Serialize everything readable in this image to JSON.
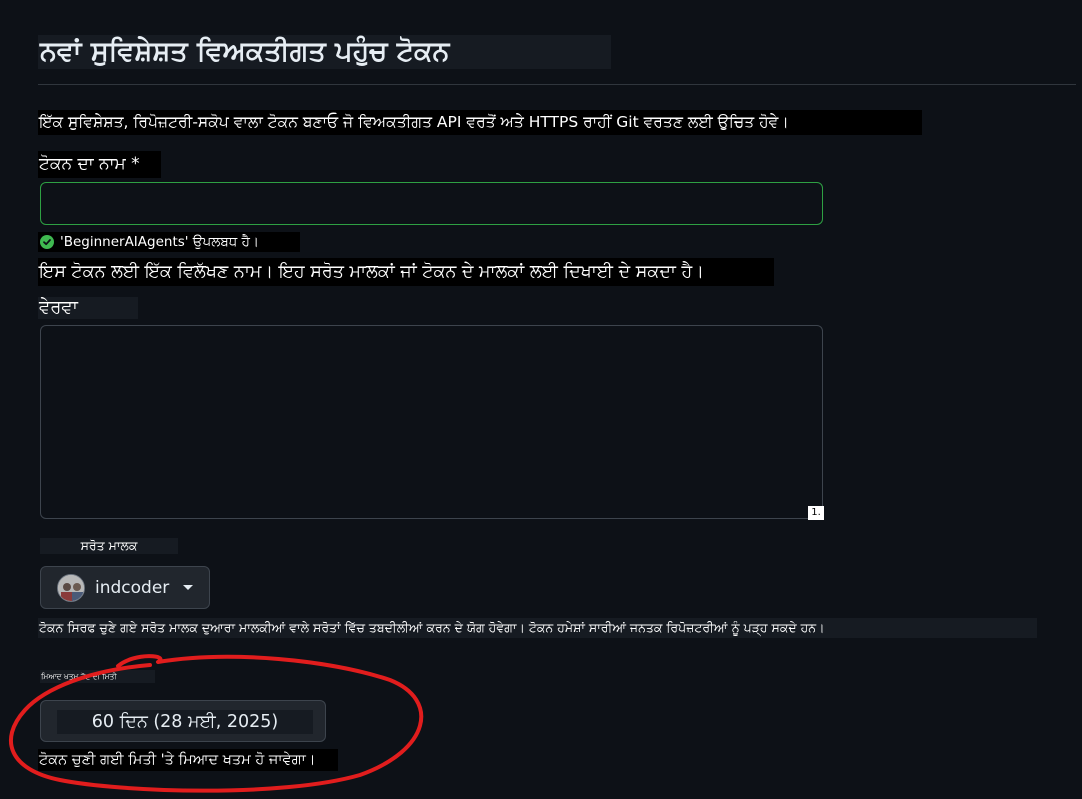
{
  "page": {
    "title": "ਨਵਾਂ ਸੁਵਿਸ਼ੇਸ਼ਤ ਵਿਅਕਤੀਗਤ ਪਹੁੰਚ ਟੋਕਨ",
    "intro": "ਇੱਕ ਸੁਵਿਸ਼ੇਸ਼ਤ, ਰਿਪੋਜ਼ਟਰੀ-ਸਕੋਪ ਵਾਲਾ ਟੋਕਨ ਬਣਾਓ ਜੋ ਵਿਅਕਤੀਗਤ API ਵਰਤੋਂ ਅਤੇ HTTPS ਰਾਹੀਂ Git ਵਰਤਣ ਲਈ ਉਚਿਤ ਹੋਵੇ।"
  },
  "token_name": {
    "label": "ਟੋਕਨ ਦਾ ਨਾਮ *",
    "value": "",
    "availability": "'BeginnerAIAgents' ਉਪਲਬਧ ਹੈ।",
    "help": "ਇਸ ਟੋਕਨ ਲਈ ਇੱਕ ਵਿਲੱਖਣ ਨਾਮ। ਇਹ ਸਰੋਤ ਮਾਲਕਾਂ ਜਾਂ ਟੋਕਨ ਦੇ ਮਾਲਕਾਂ ਲਈ ਦਿਖਾਈ ਦੇ ਸਕਦਾ ਹੈ।"
  },
  "description": {
    "label": "ਵੇਰਵਾ",
    "value": "",
    "counter": "1."
  },
  "resource_owner": {
    "label": "ਸਰੋਤ ਮਾਲਕ",
    "selected": "indcoder",
    "help": "ਟੋਕਨ ਸਿਰਫ ਚੁਣੇ ਗਏ ਸਰੋਤ ਮਾਲਕ ਦੁਆਰਾ ਮਾਲਕੀਆਂ ਵਾਲੇ ਸਰੋਤਾਂ ਵਿੱਚ ਤਬਦੀਲੀਆਂ ਕਰਨ ਦੇ ਯੋਗ ਹੋਵੇਗਾ। ਟੋਕਨ ਹਮੇਸ਼ਾਂ ਸਾਰੀਆਂ ਜਨਤਕ ਰਿਪੋਜ਼ਟਰੀਆਂ ਨੂੰ ਪੜ੍ਹ ਸਕਦੇ ਹਨ।"
  },
  "expiration": {
    "label": "ਮਿਆਦ ਖਤਮ ਹੋਣ ਦੀ ਮਿਤੀ",
    "selected": "60 ਦਿਨ (28 ਮਈ, 2025)",
    "help": "ਟੋਕਨ ਚੁਣੀ ਗਈ ਮਿਤੀ 'ਤੇ ਮਿਆਦ ਖਤਮ ਹੋ ਜਾਵੇਗਾ।"
  },
  "colors": {
    "background": "#0d1117",
    "success": "#3fb950",
    "valid_border": "#2ea043",
    "annotation": "#e11d1d"
  },
  "icons": {
    "availability": "check-circle-icon",
    "owner_dropdown": "caret-down-icon",
    "avatar": "user-avatar"
  }
}
